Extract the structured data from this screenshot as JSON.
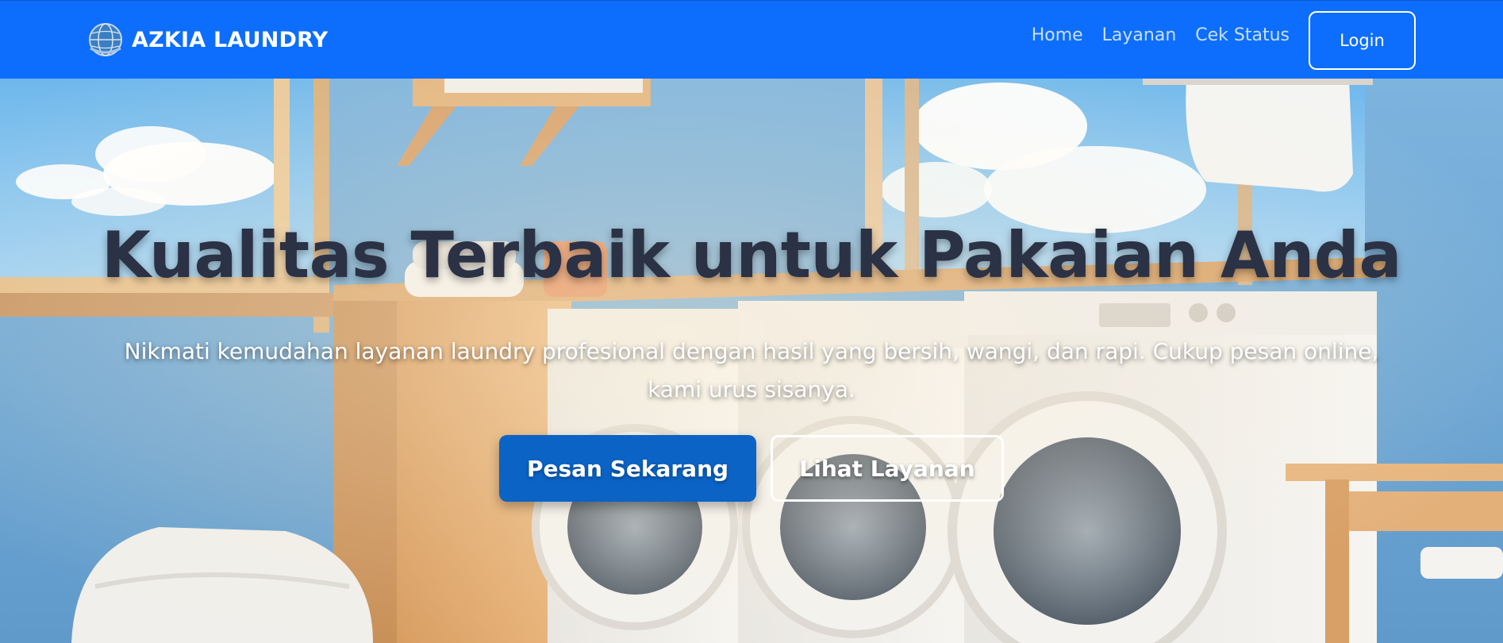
{
  "navbar": {
    "brand_name": "AZKIA LAUNDRY",
    "brand_logo_icon": "globe-emblem-icon",
    "links": [
      {
        "label": "Home"
      },
      {
        "label": "Layanan"
      },
      {
        "label": "Cek Status"
      }
    ],
    "login_label": "Login",
    "background_color": "#0d6efd"
  },
  "hero": {
    "background_image": "laundry-room-with-washing-machines",
    "title": "Kualitas Terbaik untuk Pakaian Anda",
    "subtitle": "Nikmati kemudahan layanan laundry profesional dengan hasil yang bersih, wangi, dan rapi. Cukup pesan online, kami urus sisanya.",
    "primary_button": "Pesan Sekarang",
    "secondary_button": "Lihat Layanan",
    "title_color": "#2b3245",
    "primary_button_color": "#0b63c5"
  }
}
